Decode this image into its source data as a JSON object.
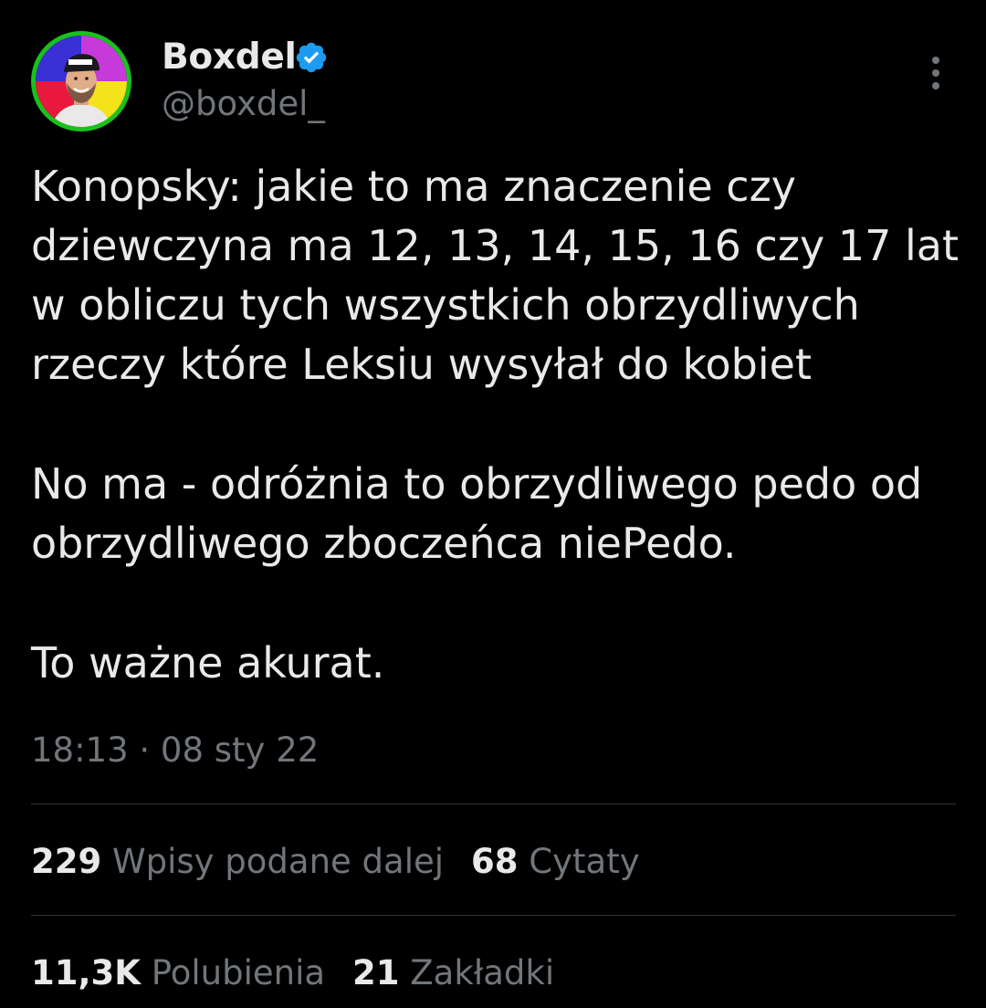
{
  "author": {
    "display_name": "Boxdel",
    "handle": "@boxdel_",
    "verified": true,
    "verified_color": "#1d9bf0",
    "avatar_ring_color": "#19c11e"
  },
  "tweet": {
    "paragraphs": [
      "Konopsky: jakie to ma znaczenie czy dziewczyna ma 12, 13, 14, 15, 16 czy 17 lat w obliczu tych wszystkich obrzydliwych rzeczy które Leksiu wysyłał do kobiet",
      "No ma - odróżnia to obrzydliwego pedo od obrzydliwego zboczeńca niePedo.",
      "To ważne akurat."
    ],
    "timestamp": "18:13 · 08 sty 22"
  },
  "stats": {
    "reposts": {
      "count": "229",
      "label": "Wpisy podane dalej"
    },
    "quotes": {
      "count": "68",
      "label": "Cytaty"
    },
    "likes": {
      "count": "11,3K",
      "label": "Polubienia"
    },
    "bookmarks": {
      "count": "21",
      "label": "Zakładki"
    }
  },
  "icons": {
    "more": "more-vertical-icon",
    "verified": "verified-badge-icon"
  },
  "colors": {
    "background": "#000000",
    "text_primary": "#e7e9ea",
    "text_secondary": "#71767b",
    "divider": "#2f3336"
  }
}
